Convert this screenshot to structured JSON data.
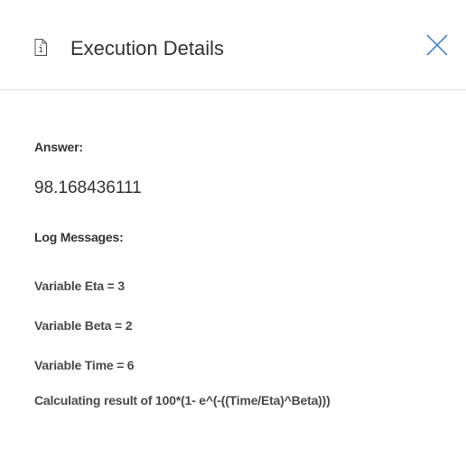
{
  "header": {
    "title": "Execution Details",
    "doc_icon": "document-info-icon",
    "close_icon": "close-icon",
    "close_color": "#4a86c8"
  },
  "answer": {
    "label": "Answer:",
    "value": "98.168436111"
  },
  "log": {
    "label": "Log Messages:",
    "messages": [
      "Variable Eta = 3",
      "Variable Beta = 2",
      "Variable Time = 6",
      "Calculating result of 100*(1- e^(-((Time/Eta)^Beta)))"
    ]
  }
}
